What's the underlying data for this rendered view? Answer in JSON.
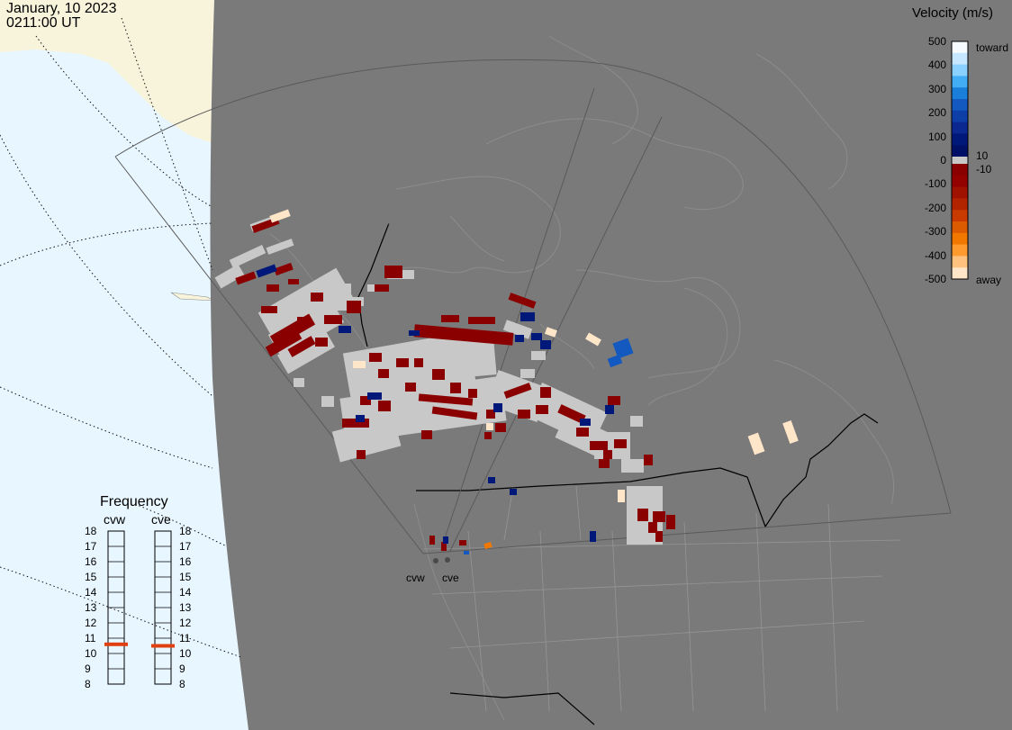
{
  "header": {
    "date": "January, 10 2023",
    "time": "0211:00 UT"
  },
  "colorbar": {
    "title": "Velocity (m/s)",
    "ticks": [
      "500",
      "400",
      "300",
      "200",
      "100",
      "0",
      "-100",
      "-200",
      "-300",
      "-400",
      "-500"
    ],
    "labels": {
      "toward": "toward",
      "away": "away",
      "pos_threshold": "10",
      "neg_threshold": "-10"
    },
    "colors": [
      "#f5fbff",
      "#c6e7ff",
      "#8ad1ff",
      "#42adf5",
      "#1a7fdb",
      "#1459bf",
      "#0e3ea8",
      "#0a2890",
      "#00187a",
      "#001066",
      "#8a0000",
      "#940200",
      "#a01200",
      "#b22400",
      "#c83a00",
      "#dc5a00",
      "#f07800",
      "#ff9a2e",
      "#ffc27e",
      "#ffe6c8"
    ]
  },
  "frequency_panel": {
    "title": "Frequency",
    "radars": [
      {
        "name": "cvw",
        "freq_mhz": 10.6
      },
      {
        "name": "cve",
        "freq_mhz": 10.5
      }
    ],
    "levels": [
      "18",
      "17",
      "16",
      "15",
      "14",
      "13",
      "12",
      "11",
      "10",
      "9",
      "8"
    ]
  },
  "radar_sites": [
    {
      "label": "cvw"
    },
    {
      "label": "cve"
    }
  ],
  "map": {
    "projection": "polar stereographic, North America",
    "colors": {
      "ocean": "#e8f6ff",
      "land_outside": "#f8f4dc",
      "night": "#7a7a7a",
      "groundscatter": "#c8c8c8",
      "grid": "#8f8f8f",
      "border": "#000000"
    }
  },
  "ticks_display": {
    "left_tick_values": [
      "18",
      "17",
      "16",
      "15",
      "14",
      "13",
      "12",
      "11",
      "10",
      "9",
      "8"
    ]
  }
}
